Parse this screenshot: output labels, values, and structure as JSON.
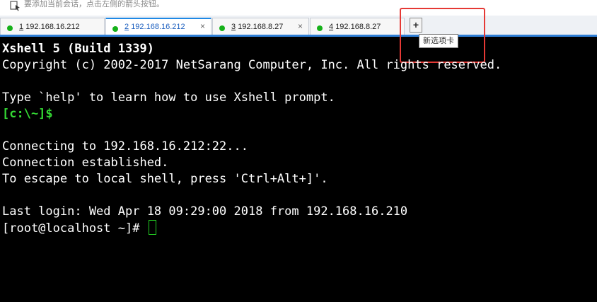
{
  "hint_bar": {
    "text": "要添加当前会话，点击左侧的箭头按钮。"
  },
  "tabs": [
    {
      "number": "1",
      "host": "192.168.16.212",
      "close": "×",
      "status_color": "#16b11a",
      "active": false
    },
    {
      "number": "2",
      "host": "192.168.16.212",
      "close": "×",
      "status_color": "#16b11a",
      "active": true
    },
    {
      "number": "3",
      "host": "192.168.8.27",
      "close": "×",
      "status_color": "#16b11a",
      "active": false
    },
    {
      "number": "4",
      "host": "192.168.8.27",
      "close": "×",
      "status_color": "#16b11a",
      "active": false
    }
  ],
  "new_tab_button": {
    "label": "+",
    "tooltip": "新选项卡"
  },
  "terminal": {
    "lines": [
      "Xshell 5 (Build 1339)",
      "Copyright (c) 2002-2017 NetSarang Computer, Inc. All rights reserved.",
      "",
      "Type `help' to learn how to use Xshell prompt.",
      "[c:\\~]$",
      "",
      "Connecting to 192.168.16.212:22...",
      "Connection established.",
      "To escape to local shell, press 'Ctrl+Alt+]'.",
      "",
      "Last login: Wed Apr 18 09:29:00 2018 from 192.168.16.210",
      "[root@localhost ~]# "
    ]
  },
  "colors": {
    "accent": "#1e88e5",
    "prompt_green": "#34d934",
    "highlight_red": "#e53935",
    "terminal_bg": "#000000"
  }
}
